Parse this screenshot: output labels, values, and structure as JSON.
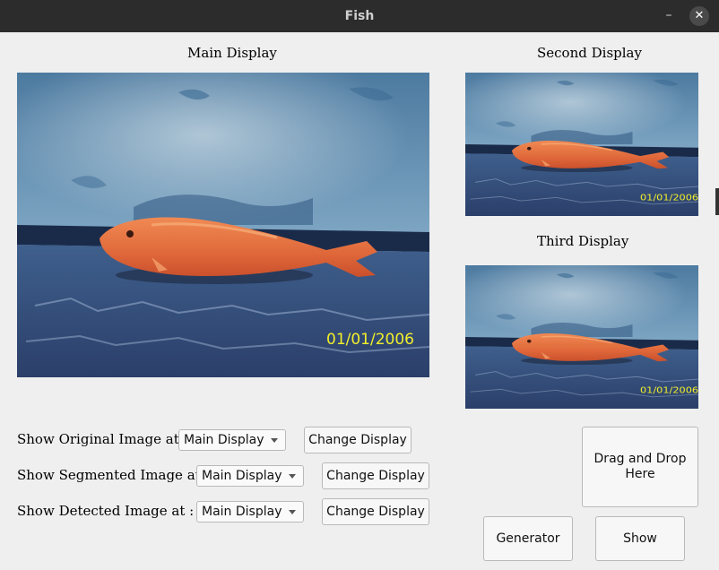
{
  "window": {
    "title": "Fish",
    "minimize_glyph": "–",
    "close_glyph": "✕"
  },
  "displays": {
    "main_label": "Main Display",
    "second_label": "Second Display",
    "third_label": "Third Display",
    "date_stamp": "01/01/2006"
  },
  "controls": {
    "original": {
      "label": "Show Original Image at :",
      "selected": "Main Display",
      "button": "Change Display"
    },
    "segmented": {
      "label": "Show Segmented Image at :",
      "selected": "Main Display",
      "button": "Change Display"
    },
    "detected": {
      "label": "Show Detected Image at :",
      "selected": "Main Display",
      "button": "Change Display"
    }
  },
  "dropzone": {
    "line1": "Drag and Drop",
    "line2": "Here"
  },
  "actions": {
    "generator": "Generator",
    "show": "Show"
  },
  "colors": {
    "titlebar": "#2c2c2c",
    "window_bg": "#efefef",
    "stamp": "#f2ef2a",
    "fish": "#e0683a"
  }
}
